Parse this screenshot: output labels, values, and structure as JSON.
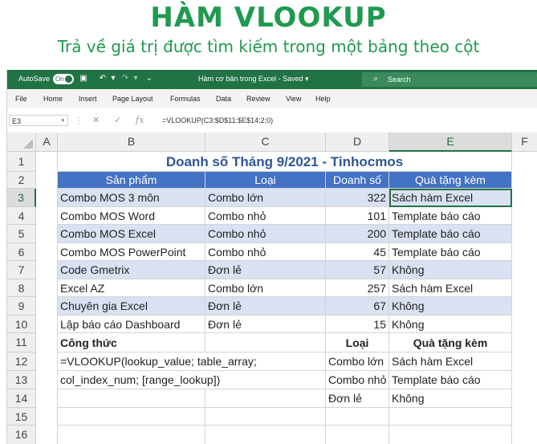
{
  "hero": {
    "title": "HÀM VLOOKUP",
    "subtitle": "Trả về giá trị được tìm kiếm trong một bảng theo cột"
  },
  "titlebar": {
    "autosave_label": "AutoSave",
    "autosave_state": "On",
    "doc_title": "Hàm cơ bản trong Excel  -  Saved  ▾",
    "search_placeholder": "Search"
  },
  "menu": [
    "File",
    "Home",
    "Insert",
    "Page Layout",
    "Formulas",
    "Data",
    "Review",
    "View",
    "Help"
  ],
  "formula_bar": {
    "name_box": "E3",
    "fx": "fx",
    "formula": "=VLOOKUP(C3;$D$11:$E$14;2;0)"
  },
  "columns": [
    "A",
    "B",
    "C",
    "D",
    "E",
    "F"
  ],
  "rows": [
    "1",
    "2",
    "3",
    "4",
    "5",
    "6",
    "7",
    "8",
    "9",
    "10",
    "11",
    "12",
    "13",
    "14",
    "15",
    "16"
  ],
  "sheet": {
    "title": "Doanh số Tháng 9/2021 - Tinhocmos",
    "headers": [
      "Sản phẩm",
      "Loại",
      "Doanh số",
      "Quà tặng kèm"
    ],
    "data": [
      [
        "Combo MOS 3 môn",
        "Combo lớn",
        "322",
        "Sách hàm Excel"
      ],
      [
        "Combo MOS Word",
        "Combo nhỏ",
        "101",
        "Template báo cáo"
      ],
      [
        "Combo MOS Excel",
        "Combo nhỏ",
        "200",
        "Template báo cáo"
      ],
      [
        "Combo MOS PowerPoint",
        "Combo nhỏ",
        "45",
        "Template báo cáo"
      ],
      [
        "Code Gmetrix",
        "Đơn lẻ",
        "57",
        "Không"
      ],
      [
        "Excel AZ",
        "Combo lớn",
        "257",
        "Sách hàm Excel"
      ],
      [
        "Chuyên gia Excel",
        "Đơn lẻ",
        "67",
        "Không"
      ],
      [
        "Lập báo cáo Dashboard",
        "Đơn lẻ",
        "15",
        "Không"
      ]
    ],
    "formula_label": "Công thức",
    "formula_line1": "=VLOOKUP(lookup_value; table_array;",
    "formula_line2": "col_index_num; [range_lookup])",
    "lookup_headers": [
      "Loại",
      "Quà tặng kèm"
    ],
    "lookup": [
      [
        "Combo lớn",
        "Sách hàm Excel"
      ],
      [
        "Combo nhỏ",
        "Template báo cáo"
      ],
      [
        "Đơn lẻ",
        "Không"
      ]
    ]
  },
  "colors": {
    "brand_green": "#217346",
    "hero_green": "#1f9a4e",
    "header_blue": "#4472c4",
    "band_blue": "#d9e1f2",
    "title_blue": "#2f5597"
  }
}
